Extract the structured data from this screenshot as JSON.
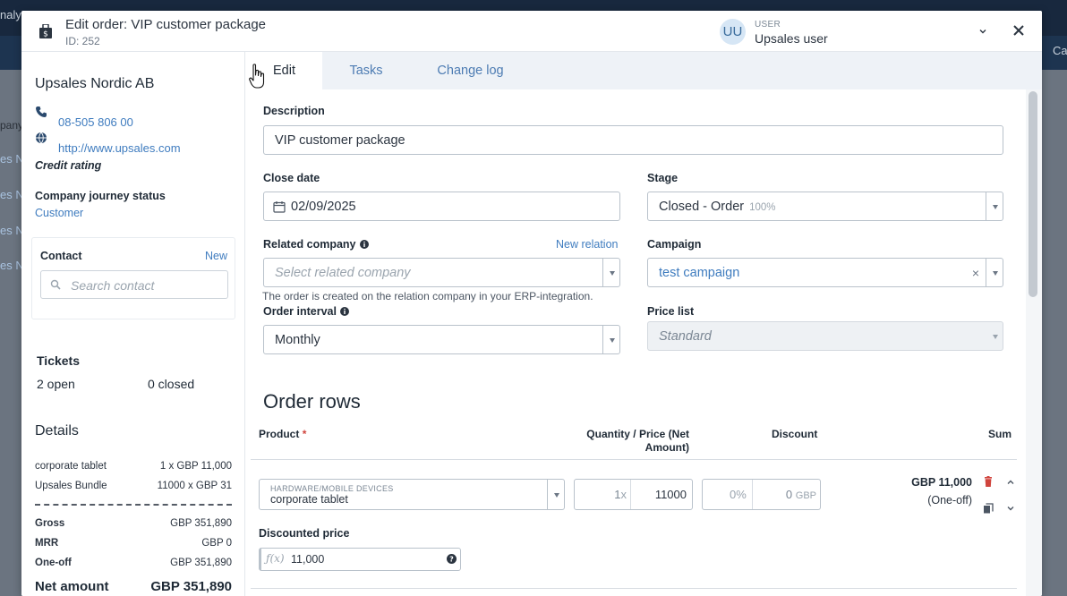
{
  "background": {
    "partial_texts": [
      "nalyt",
      "Ca",
      "pany",
      "es N",
      "es N",
      "es N",
      "es N"
    ]
  },
  "header": {
    "title": "Edit order: VIP customer package",
    "order_id": "ID: 252",
    "user_initials": "UU",
    "user_label": "USER",
    "user_name": "Upsales user"
  },
  "sidebar": {
    "company_name": "Upsales Nordic AB",
    "phone": "08-505 806 00",
    "website": "http://www.upsales.com",
    "credit_rating_label": "Credit rating",
    "journey_label": "Company journey status",
    "journey_value": "Customer",
    "contact": {
      "label": "Contact",
      "new_label": "New",
      "search_placeholder": "Search contact"
    },
    "tickets": {
      "label": "Tickets",
      "open": "2 open",
      "closed": "0 closed"
    },
    "details": {
      "label": "Details",
      "items": [
        {
          "name": "corporate tablet",
          "value": "1 x GBP 11,000"
        },
        {
          "name": "Upsales Bundle",
          "value": "11000 x GBP 31"
        }
      ],
      "totals": [
        {
          "name": "Gross",
          "value": "GBP 351,890"
        },
        {
          "name": "MRR",
          "value": "GBP 0"
        },
        {
          "name": "One-off",
          "value": "GBP 351,890"
        }
      ],
      "net_label": "Net amount",
      "net_value": "GBP 351,890"
    }
  },
  "tabs": [
    {
      "label": "Edit",
      "active": true
    },
    {
      "label": "Tasks",
      "active": false
    },
    {
      "label": "Change log",
      "active": false
    }
  ],
  "form": {
    "description_label": "Description",
    "description_value": "VIP customer package",
    "close_date_label": "Close date",
    "close_date_value": "02/09/2025",
    "stage_label": "Stage",
    "stage_value": "Closed - Order",
    "stage_probability": "100%",
    "related_company_label": "Related company",
    "new_relation_label": "New relation",
    "related_company_placeholder": "Select related company",
    "related_company_hint": "The order is created on the relation company in your ERP-integration.",
    "campaign_label": "Campaign",
    "campaign_value": "test campaign",
    "order_interval_label": "Order interval",
    "order_interval_value": "Monthly",
    "price_list_label": "Price list",
    "price_list_value": "Standard"
  },
  "order_rows": {
    "title": "Order rows",
    "columns": {
      "product": "Product",
      "required_marker": "*",
      "quantity_price_line1": "Quantity / Price (Net",
      "quantity_price_line2": "Amount)",
      "discount": "Discount",
      "sum": "Sum"
    },
    "rows": [
      {
        "category": "HARDWARE/MOBILE DEVICES",
        "product": "corporate tablet",
        "quantity": "1",
        "quantity_suffix": "x",
        "price": "11000",
        "discount_percent": "0",
        "discount_percent_suffix": "%",
        "discount_amount": "0",
        "discount_currency": "GBP",
        "sum": "GBP 11,000",
        "sum_type": "(One-off)"
      }
    ],
    "discounted_price_label": "Discounted price",
    "discounted_price_fx": "ƒ(x)",
    "discounted_price_value": "11,000"
  },
  "colors": {
    "accent": "#3f7cbf",
    "delete": "#d0443d",
    "tab_bar": "#eef2f7"
  }
}
